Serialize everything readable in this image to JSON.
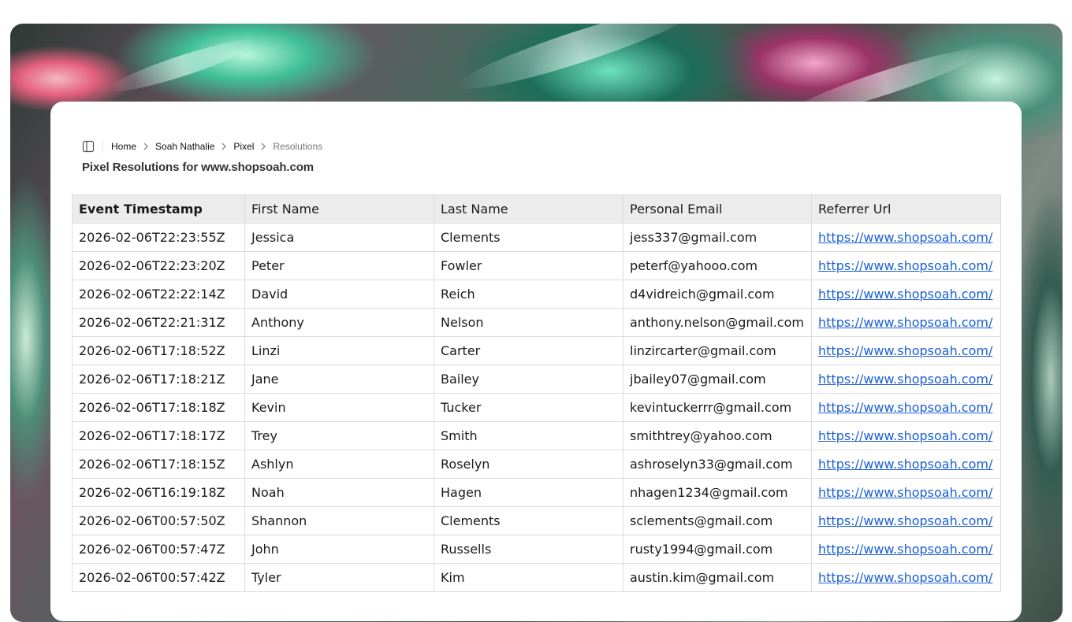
{
  "breadcrumb": {
    "items": [
      {
        "label": "Home"
      },
      {
        "label": "Soah Nathalie"
      },
      {
        "label": "Pixel"
      },
      {
        "label": "Resolutions"
      }
    ]
  },
  "page": {
    "title": "Pixel Resolutions for www.shopsoah.com"
  },
  "table": {
    "columns": [
      "Event Timestamp",
      "First Name",
      "Last Name",
      "Personal Email",
      "Referrer Url"
    ],
    "rows": [
      [
        "2026-02-06T22:23:55Z",
        "Jessica",
        "Clements",
        "jess337@gmail.com",
        "https://www.shopsoah.com/"
      ],
      [
        "2026-02-06T22:23:20Z",
        "Peter",
        "Fowler",
        "peterf@yahooo.com",
        "https://www.shopsoah.com/"
      ],
      [
        "2026-02-06T22:22:14Z",
        "David",
        "Reich",
        "d4vidreich@gmail.com",
        "https://www.shopsoah.com/"
      ],
      [
        "2026-02-06T22:21:31Z",
        "Anthony",
        "Nelson",
        "anthony.nelson@gmail.com",
        "https://www.shopsoah.com/"
      ],
      [
        "2026-02-06T17:18:52Z",
        "Linzi",
        "Carter",
        "linzircarter@gmail.com",
        "https://www.shopsoah.com/"
      ],
      [
        "2026-02-06T17:18:21Z",
        "Jane",
        "Bailey",
        "jbailey07@gmail.com",
        "https://www.shopsoah.com/"
      ],
      [
        "2026-02-06T17:18:18Z",
        "Kevin",
        "Tucker",
        "kevintuckerrr@gmail.com",
        "https://www.shopsoah.com/"
      ],
      [
        "2026-02-06T17:18:17Z",
        "Trey",
        "Smith",
        "smithtrey@yahoo.com",
        "https://www.shopsoah.com/"
      ],
      [
        "2026-02-06T17:18:15Z",
        "Ashlyn",
        "Roselyn",
        "ashroselyn33@gmail.com",
        "https://www.shopsoah.com/"
      ],
      [
        "2026-02-06T16:19:18Z",
        "Noah",
        "Hagen",
        "nhagen1234@gmail.com",
        "https://www.shopsoah.com/"
      ],
      [
        "2026-02-06T00:57:50Z",
        "Shannon",
        "Clements",
        "sclements@gmail.com",
        "https://www.shopsoah.com/"
      ],
      [
        "2026-02-06T00:57:47Z",
        "John",
        "Russells",
        "rusty1994@gmail.com",
        "https://www.shopsoah.com/"
      ],
      [
        "2026-02-06T00:57:42Z",
        "Tyler",
        "Kim",
        "austin.kim@gmail.com",
        "https://www.shopsoah.com/"
      ]
    ]
  },
  "icons": {
    "sidebar_toggle": "sidebar-toggle-icon",
    "breadcrumb_separator": "chevron-right-icon"
  },
  "colors": {
    "link": "#1a5fd6",
    "header_bg": "#ececec",
    "border": "#dcdcdc"
  }
}
